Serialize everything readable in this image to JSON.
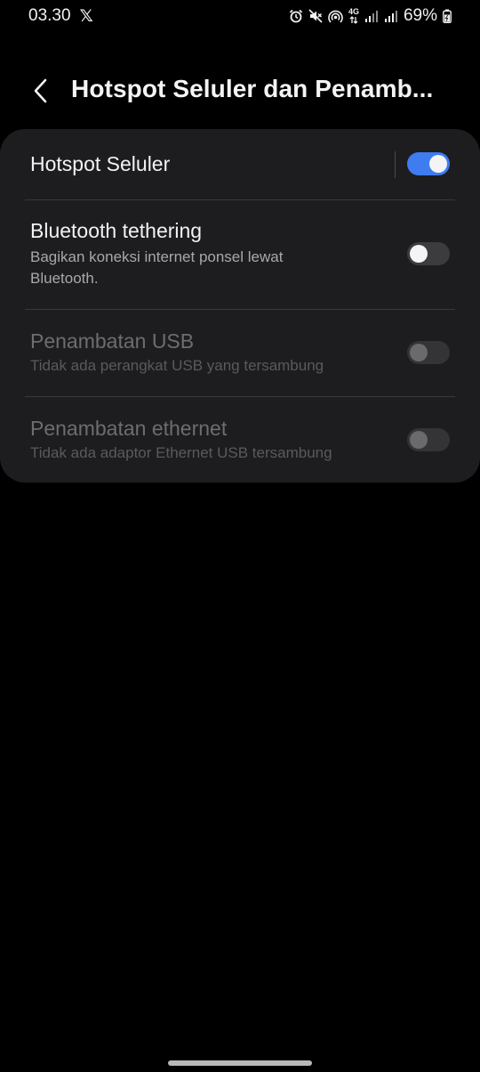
{
  "status_bar": {
    "time": "03.30",
    "app_icon": "x-icon",
    "x_glyph": "𝕏",
    "network_label": "4G",
    "battery": "69%"
  },
  "header": {
    "back_icon": "chevron-left-icon",
    "title": "Hotspot Seluler dan Penamb..."
  },
  "settings": {
    "hotspot": {
      "title": "Hotspot Seluler",
      "enabled": true
    },
    "bluetooth": {
      "title": "Bluetooth tethering",
      "subtitle": "Bagikan koneksi internet ponsel lewat Bluetooth.",
      "enabled": false
    },
    "usb": {
      "title": "Penambatan USB",
      "subtitle": "Tidak ada perangkat USB yang tersambung",
      "enabled": false,
      "available": false
    },
    "ethernet": {
      "title": "Penambatan ethernet",
      "subtitle": "Tidak ada adaptor Ethernet USB tersambung",
      "enabled": false,
      "available": false
    }
  },
  "colors": {
    "background": "#000000",
    "card": "#1d1d20",
    "accent": "#3e7cf0"
  }
}
